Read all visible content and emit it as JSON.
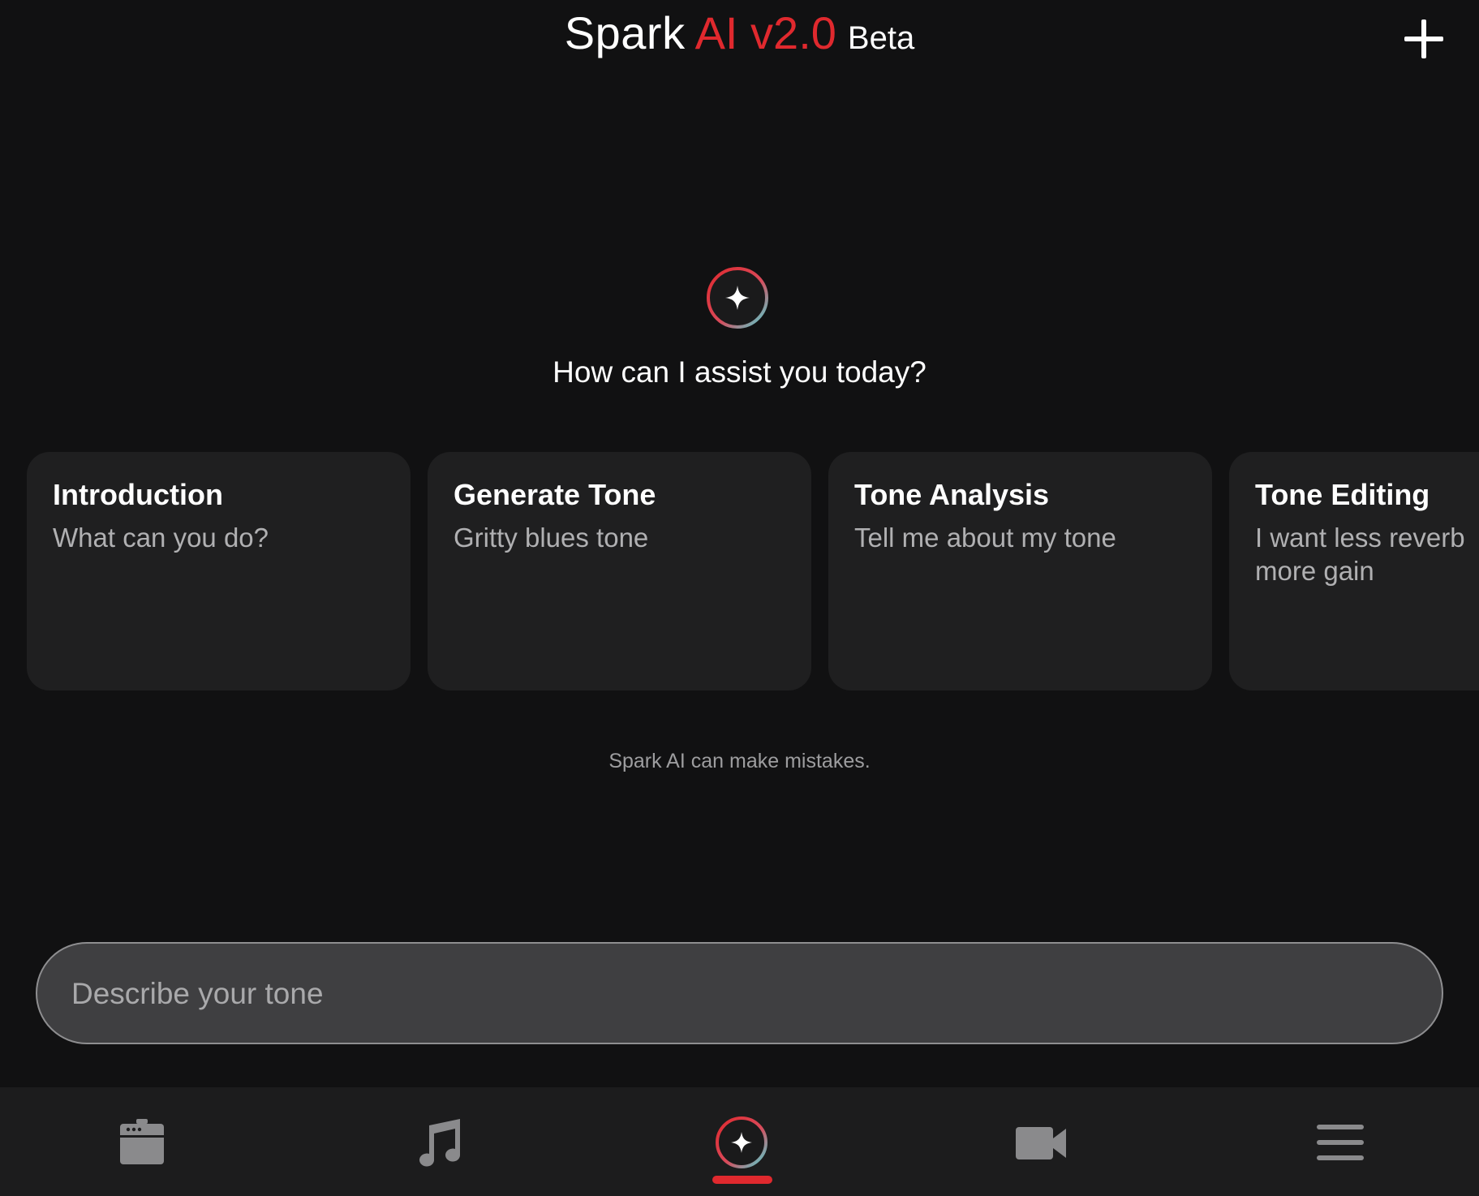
{
  "header": {
    "title_main": "Spark",
    "title_accent": "AI v2.0",
    "title_beta": "Beta",
    "new_chat_icon": "plus-icon"
  },
  "hero": {
    "icon": "sparkle-icon",
    "prompt": "How can I assist you today?"
  },
  "suggestions": [
    {
      "title": "Introduction",
      "subtitle": "What can you do?"
    },
    {
      "title": "Generate Tone",
      "subtitle": "Gritty blues tone"
    },
    {
      "title": "Tone Analysis",
      "subtitle": "Tell me about my tone"
    },
    {
      "title": "Tone Editing",
      "subtitle": "I want less reverb more gain"
    }
  ],
  "disclaimer": "Spark AI can make mistakes.",
  "input": {
    "placeholder": "Describe your tone",
    "value": ""
  },
  "bottom_nav": {
    "items": [
      {
        "name": "amp",
        "icon": "amplifier-icon",
        "active": false
      },
      {
        "name": "music",
        "icon": "music-note-icon",
        "active": false
      },
      {
        "name": "spark-ai",
        "icon": "sparkle-icon",
        "active": true
      },
      {
        "name": "video",
        "icon": "video-camera-icon",
        "active": false
      },
      {
        "name": "menu",
        "icon": "hamburger-menu-icon",
        "active": false
      }
    ]
  },
  "colors": {
    "background": "#111112",
    "accent_red": "#e0292e",
    "accent_teal": "#4fd6d6",
    "card_bg": "#1f1f20",
    "nav_bg": "#1c1c1d",
    "inactive_icon": "#8a8a8c"
  }
}
